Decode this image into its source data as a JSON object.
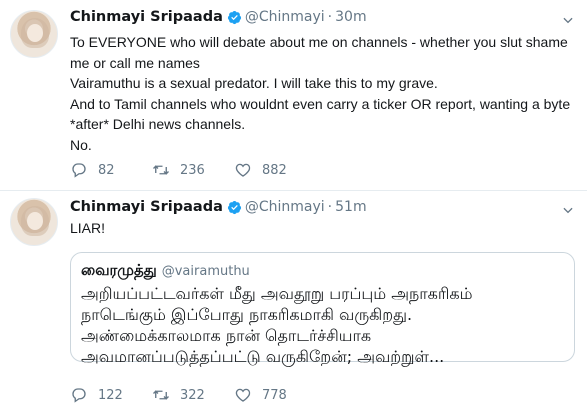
{
  "colors": {
    "text": "#14171a",
    "secondary": "#657786",
    "verified": "#1da1f2",
    "border": "#e6ecf0"
  },
  "tweets": [
    {
      "author": {
        "display_name": "Chinmayi Sripaada",
        "handle": "@Chinmayi",
        "verified": true
      },
      "time": "30m",
      "text_lines": [
        "To EVERYONE who will debate about me on channels - whether you slut shame",
        "me or call me names",
        "Vairamuthu is a sexual predator. I will take this to my grave.",
        "And to Tamil channels who wouldnt even carry a ticker OR report, wanting a byte",
        "*after* Delhi news channels.",
        "No."
      ],
      "stats": {
        "replies": "82",
        "retweets": "236",
        "likes": "882"
      }
    },
    {
      "author": {
        "display_name": "Chinmayi Sripaada",
        "handle": "@Chinmayi",
        "verified": true
      },
      "time": "51m",
      "text_lines": [
        "LIAR!"
      ],
      "quoted": {
        "display_name": "வைரமுத்து",
        "handle": "@vairamuthu",
        "text_lines": [
          "அறியப்பட்டவர்கள் மீது அவதூறு பரப்பும் அநாகரிகம்",
          "நாடெங்கும் இப்போது நாகரிகமாகி வருகிறது.",
          "அண்மைக்காலமாக நான் தொடர்ச்சியாக",
          "அவமானப்படுத்தப்பட்டு வருகிறேன்; அவற்றுள்..."
        ]
      },
      "stats": {
        "replies": "122",
        "retweets": "322",
        "likes": "778"
      }
    }
  ],
  "icons": {
    "verified": "verified-badge-icon",
    "caret": "chevron-down-icon",
    "reply": "reply-icon",
    "retweet": "retweet-icon",
    "like": "heart-icon"
  }
}
